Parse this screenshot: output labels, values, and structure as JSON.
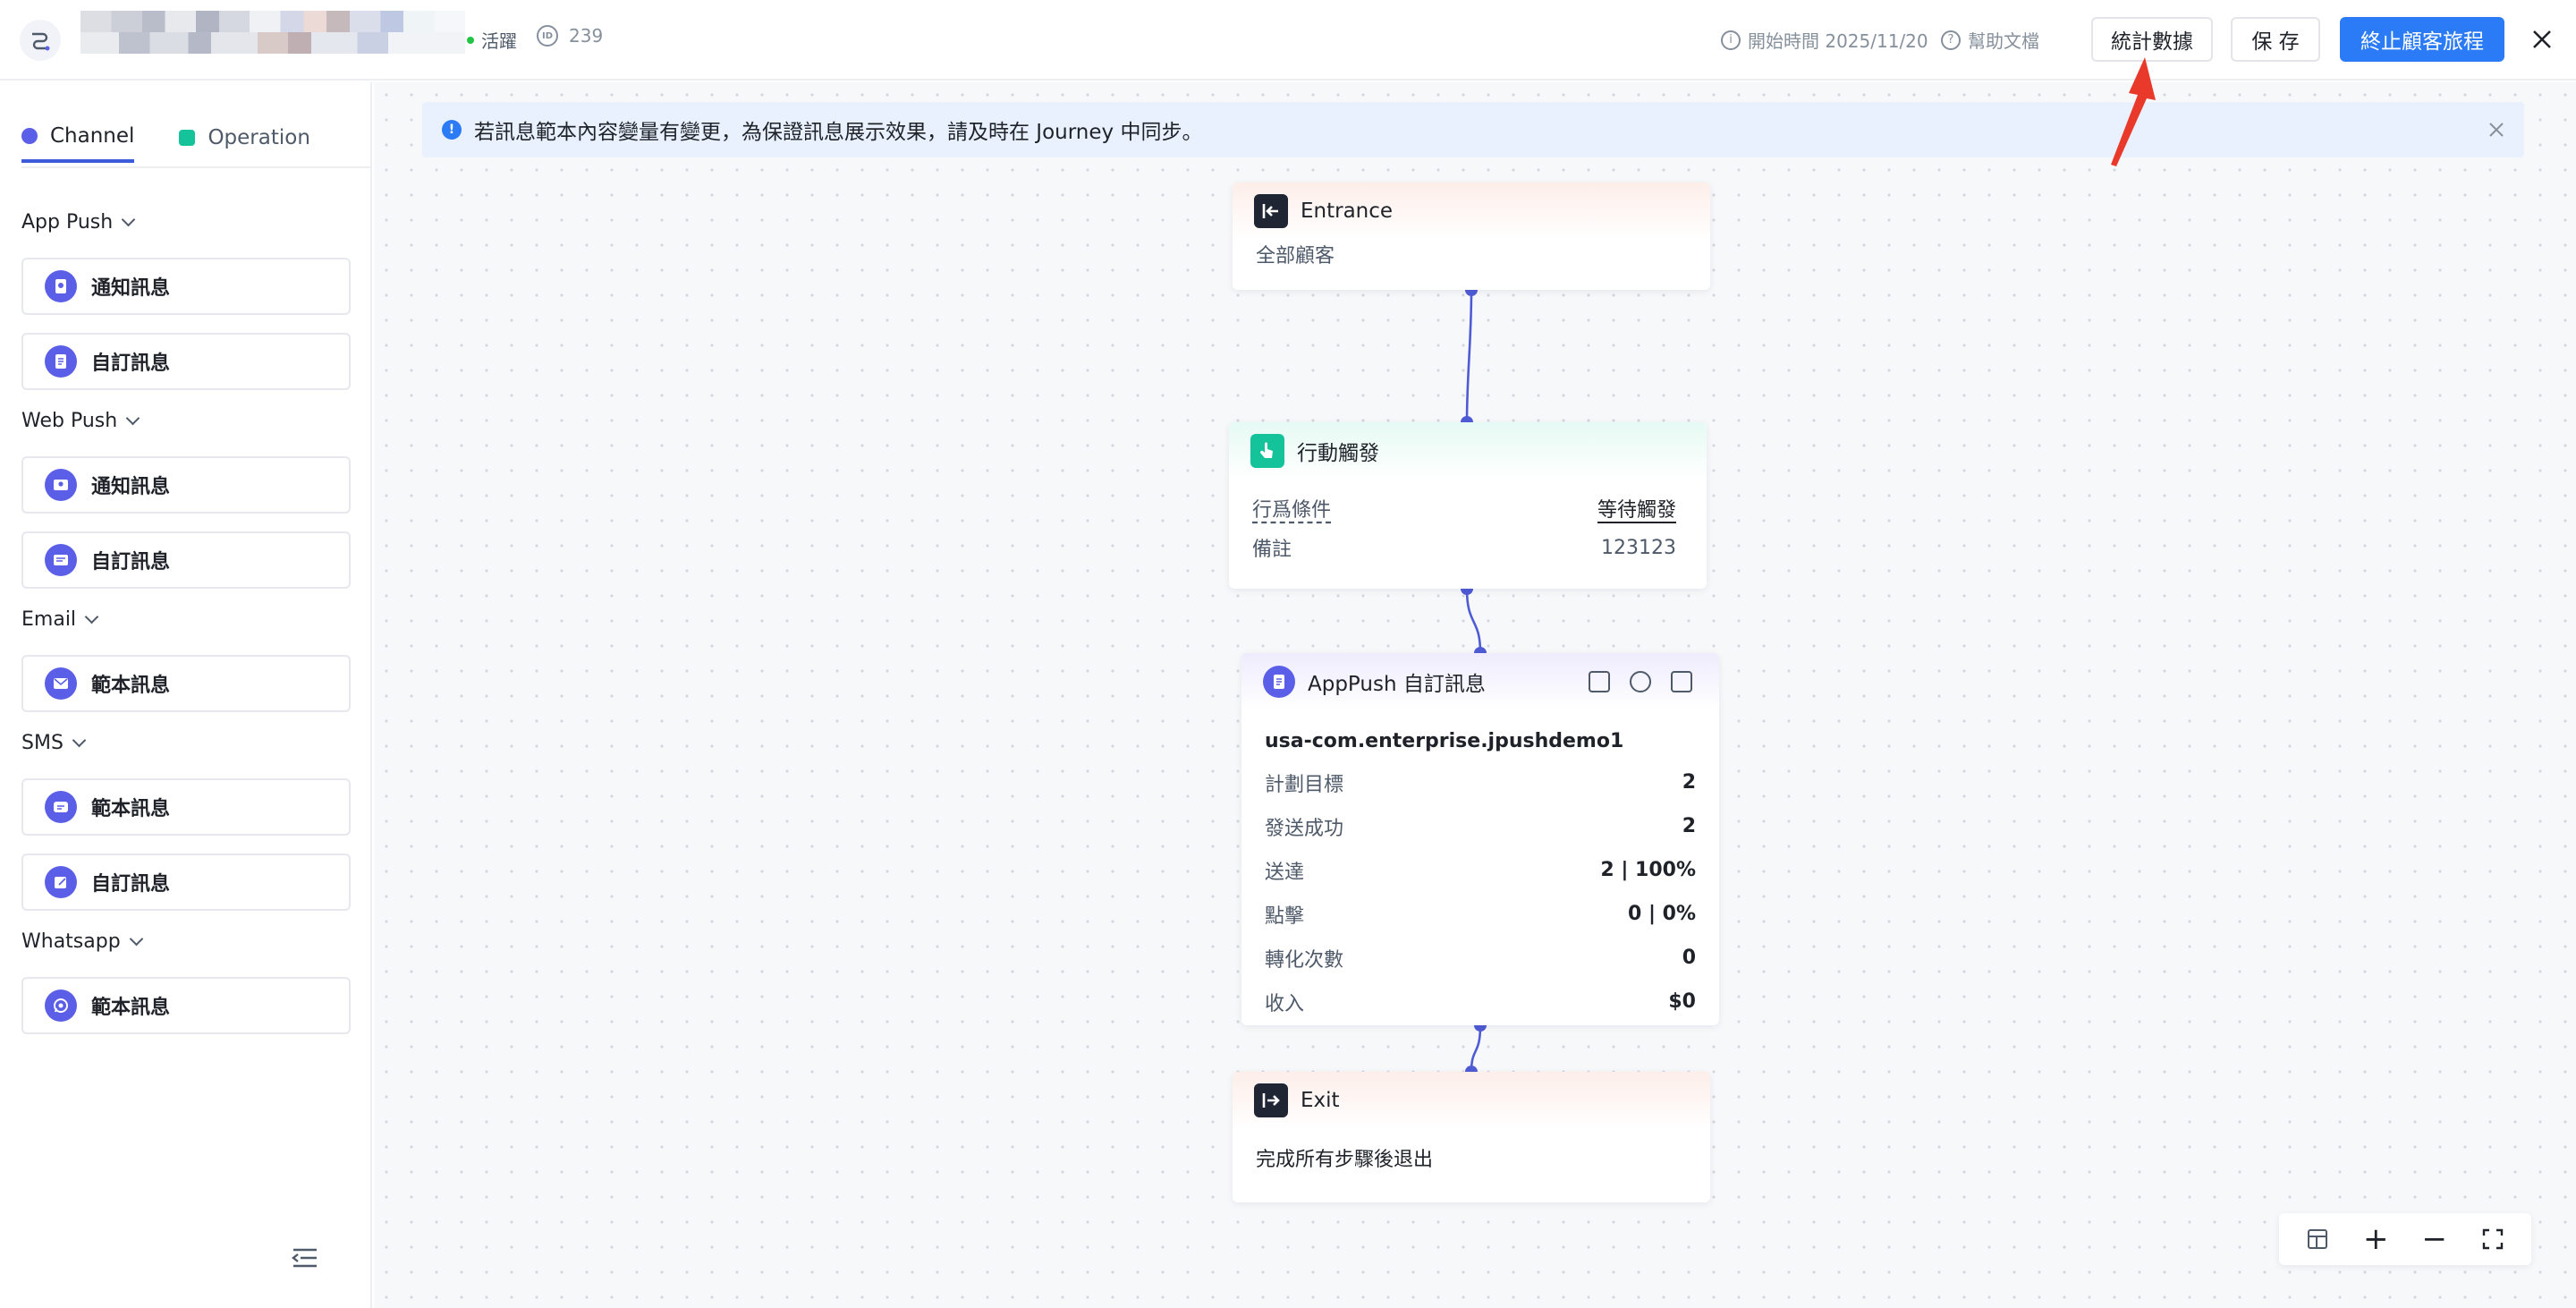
{
  "header": {
    "status": "活躍",
    "id_icon": "ID",
    "id": "239",
    "start_time": "開始時間 2025/11/20",
    "help": "幫助文檔",
    "stats_button": "統計數據",
    "save_button": "保 存",
    "stop_button": "終止顧客旅程",
    "close_icon": "close-icon",
    "status_color": "#23c343",
    "accent_color": "#2b7bf6"
  },
  "sidebar": {
    "tabs": [
      {
        "label": "Channel",
        "color": "#5b5fe8"
      },
      {
        "label": "Operation",
        "color": "#15c39a"
      }
    ],
    "groups": [
      {
        "title": "App Push",
        "items": [
          "通知訊息",
          "自訂訊息"
        ]
      },
      {
        "title": "Web Push",
        "items": [
          "通知訊息",
          "自訂訊息"
        ]
      },
      {
        "title": "Email",
        "items": [
          "範本訊息"
        ]
      },
      {
        "title": "SMS",
        "items": [
          "範本訊息",
          "自訂訊息"
        ]
      },
      {
        "title": "Whatsapp",
        "items": [
          "範本訊息"
        ]
      }
    ]
  },
  "notice": {
    "icon": "!",
    "text": "若訊息範本內容變量有變更，為保證訊息展示效果，請及時在 Journey 中同步。"
  },
  "nodes": {
    "entrance": {
      "title": "Entrance",
      "body": "全部顧客"
    },
    "action": {
      "title": "行動觸發",
      "condition_label": "行爲條件",
      "condition_value": "等待觸發",
      "note_label": "備註",
      "note_value": "123123"
    },
    "apppush": {
      "title": "AppPush 自訂訊息",
      "app": "usa-com.enterprise.jpushdemo1",
      "rows": [
        {
          "label": "計劃目標",
          "value": "2"
        },
        {
          "label": "發送成功",
          "value": "2"
        },
        {
          "label": "送達",
          "value": "2 | 100%"
        },
        {
          "label": "點擊",
          "value": "0 | 0%"
        },
        {
          "label": "轉化次數",
          "value": "0"
        },
        {
          "label": "收入",
          "value": "$0"
        }
      ]
    },
    "exit": {
      "title": "Exit",
      "body": "完成所有步驟後退出"
    }
  },
  "zoom": {
    "layout_icon": "layout-icon",
    "zoom_in": "+",
    "zoom_out": "−",
    "fullscreen_icon": "fullscreen-icon"
  }
}
